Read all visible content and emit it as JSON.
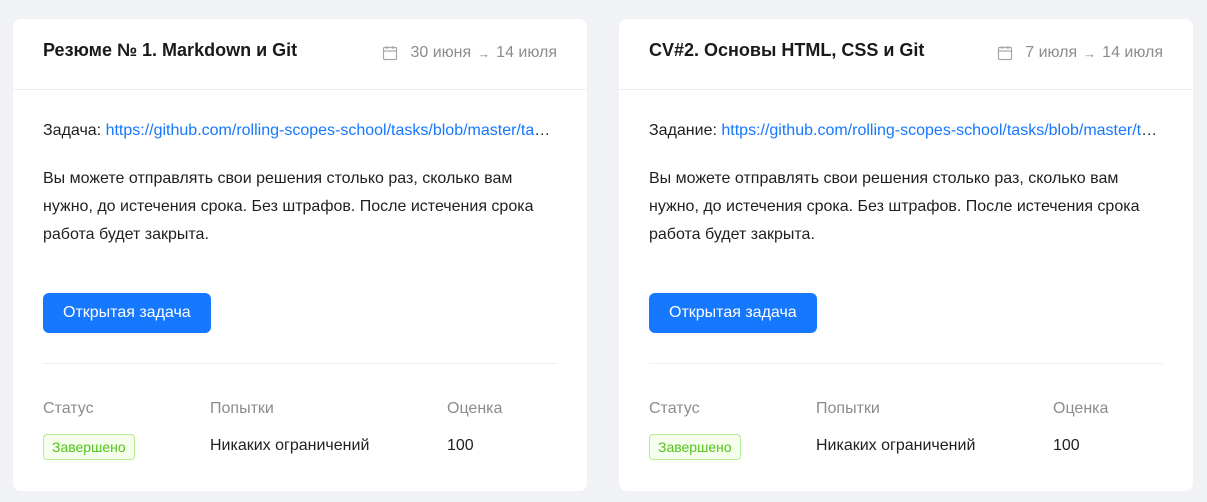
{
  "cards": [
    {
      "title": "Резюме № 1. Markdown и Git",
      "date_start": "30 июня",
      "date_end": "14 июля",
      "date_arrow": "→",
      "task_label": "Задача:",
      "task_link": "https://github.com/rolling-scopes-school/tasks/blob/master/tasks/cv/markdown-and-git.md",
      "description": "Вы можете отправлять свои решения столько раз, сколько вам нужно, до истечения срока. Без штрафов. После истечения срока работа будет закрыта.",
      "button_label": "Открытая задача",
      "status_header": "Статус",
      "attempts_header": "Попытки",
      "score_header": "Оценка",
      "status_value": "Завершено",
      "attempts_value": "Никаких ограничений",
      "score_value": "100"
    },
    {
      "title": "CV#2. Основы HTML, CSS и Git",
      "date_start": "7 июля",
      "date_end": "14 июля",
      "date_arrow": "→",
      "task_label": "Задание:",
      "task_link": "https://github.com/rolling-scopes-school/tasks/blob/master/tasks/cv/html-css.md",
      "description": "Вы можете отправлять свои решения столько раз, сколько вам нужно, до истечения срока. Без штрафов. После истечения срока работа будет закрыта.",
      "button_label": "Открытая задача",
      "status_header": "Статус",
      "attempts_header": "Попытки",
      "score_header": "Оценка",
      "status_value": "Завершено",
      "attempts_value": "Никаких ограничений",
      "score_value": "100"
    }
  ],
  "icons": {
    "date": "calendar-icon"
  },
  "colors": {
    "accent": "#1677ff",
    "success_text": "#52c41a",
    "success_bg": "#f6ffed",
    "success_border": "#b7eb8f",
    "muted": "#8c8c8c"
  }
}
